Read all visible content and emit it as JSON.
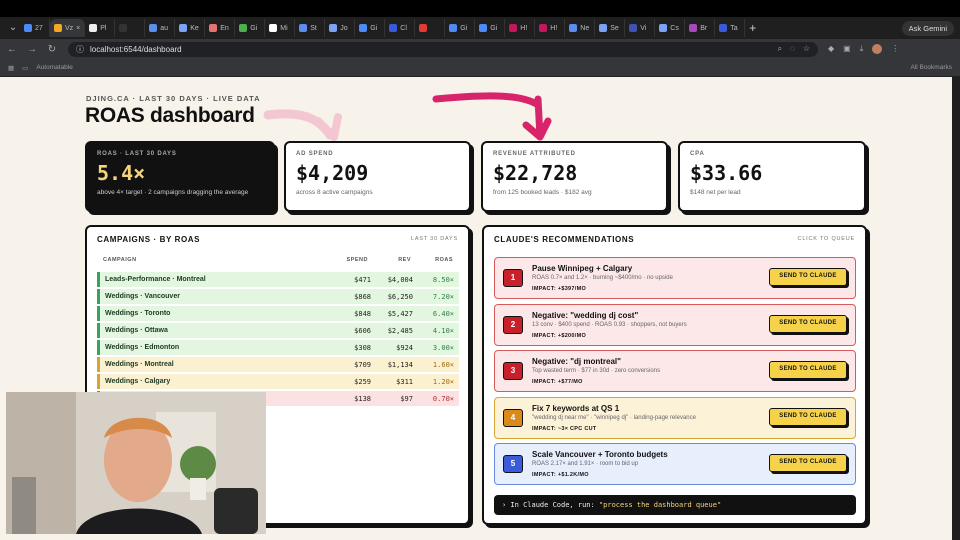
{
  "browser": {
    "tabs": [
      "27",
      "Vz",
      "Pl",
      "",
      "au",
      "Ke",
      "En",
      "Gi",
      "Mi",
      "St",
      "Jo",
      "Gi",
      "Cl",
      "",
      "Gi",
      "Gi",
      "H!",
      "H!",
      "Ne",
      "Se",
      "Vi",
      "Cs",
      "Br",
      "Ta"
    ],
    "gemini_label": "Ask Gemini",
    "url": "localhost:6544/dashboard",
    "bookmark_left": "Automatable",
    "bookmark_right": "All Bookmarks"
  },
  "header": {
    "kicker": "DJING.CA · LAST 30 DAYS · LIVE DATA",
    "title": "ROAS dashboard"
  },
  "cards": [
    {
      "label": "ROAS · LAST 30 DAYS",
      "value": "5.4×",
      "sub": "above 4× target · 2 campaigns dragging the average"
    },
    {
      "label": "AD SPEND",
      "value": "$4,209",
      "sub": "across 8 active campaigns"
    },
    {
      "label": "REVENUE ATTRIBUTED",
      "value": "$22,728",
      "sub": "from 125 booked leads · $182 avg"
    },
    {
      "label": "CPA",
      "value": "$33.66",
      "sub": "$148 net per lead"
    }
  ],
  "campaigns": {
    "title": "CAMPAIGNS · BY ROAS",
    "hint": "LAST 30 DAYS",
    "columns": {
      "campaign": "CAMPAIGN",
      "spend": "SPEND",
      "rev": "REV",
      "roas": "ROAS"
    },
    "rows": [
      {
        "name": "Leads-Performance · Montreal",
        "spend": "$471",
        "rev": "$4,004",
        "roas": "8.50×",
        "status": "good"
      },
      {
        "name": "Weddings · Vancouver",
        "spend": "$868",
        "rev": "$6,250",
        "roas": "7.20×",
        "status": "good"
      },
      {
        "name": "Weddings · Toronto",
        "spend": "$848",
        "rev": "$5,427",
        "roas": "6.40×",
        "status": "good"
      },
      {
        "name": "Weddings · Ottawa",
        "spend": "$606",
        "rev": "$2,485",
        "roas": "4.10×",
        "status": "good"
      },
      {
        "name": "Weddings · Edmonton",
        "spend": "$308",
        "rev": "$924",
        "roas": "3.00×",
        "status": "good"
      },
      {
        "name": "Weddings · Montreal",
        "spend": "$709",
        "rev": "$1,134",
        "roas": "1.60×",
        "status": "warn"
      },
      {
        "name": "Weddings · Calgary",
        "spend": "$259",
        "rev": "$311",
        "roas": "1.20×",
        "status": "warn"
      },
      {
        "name": "",
        "spend": "$138",
        "rev": "$97",
        "roas": "0.70×",
        "status": "bad"
      }
    ]
  },
  "recommendations": {
    "title": "CLAUDE'S RECOMMENDATIONS",
    "hint": "CLICK TO QUEUE",
    "button_label": "SEND TO CLAUDE",
    "items": [
      {
        "num": "1",
        "title": "Pause Winnipeg + Calgary",
        "sub": "ROAS 0.7× and 1.2× · burning ~$400/mo · no upside",
        "impact": "IMPACT: +$397/MO",
        "tone": "red"
      },
      {
        "num": "2",
        "title": "Negative: \"wedding dj cost\"",
        "sub": "13 conv · $400 spend · ROAS 0.93 · shoppers, not buyers",
        "impact": "IMPACT: +$200/MO",
        "tone": "red"
      },
      {
        "num": "3",
        "title": "Negative: \"dj montreal\"",
        "sub": "Top wasted term · $77 in 30d · zero conversions",
        "impact": "IMPACT: +$77/MO",
        "tone": "red"
      },
      {
        "num": "4",
        "title": "Fix 7 keywords at QS 1",
        "sub": "\"wedding dj near me\" · \"winnipeg dj\" · landing-page relevance",
        "impact": "IMPACT: ~3× CPC CUT",
        "tone": "orange"
      },
      {
        "num": "5",
        "title": "Scale Vancouver + Toronto budgets",
        "sub": "ROAS 2.17× and 1.91× · room to bid up",
        "impact": "IMPACT: +$1.2K/MO",
        "tone": "blue"
      }
    ],
    "command_prefix": "› In Claude Code, run:",
    "command_quote": "\"process the dashboard queue\""
  },
  "colors": {
    "good_bg": "#e3f6df",
    "good_border": "#3aa35a",
    "warn_bg": "#fbf0cf",
    "warn_border": "#d7a531",
    "bad_bg": "#fbe1e1",
    "bad_border": "#d95a5a",
    "red_num": "#c8202a",
    "orange_num": "#d98a1a",
    "blue_num": "#3a5bd9",
    "accent_yellow": "#f6d24a",
    "arrow_pink": "#d8246a"
  }
}
